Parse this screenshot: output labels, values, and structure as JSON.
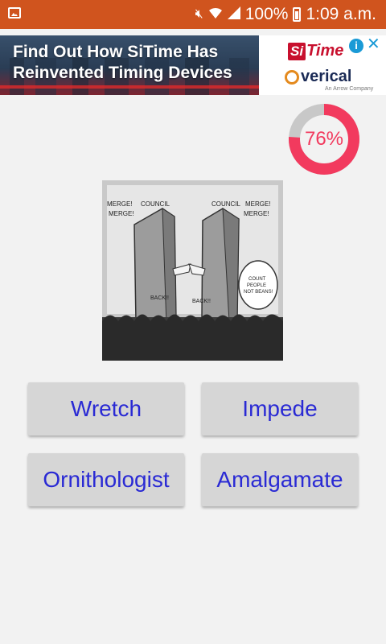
{
  "status_bar": {
    "battery_percent": "100%",
    "time": "1:09 a.m.",
    "icons": [
      "image-icon",
      "mute-icon",
      "wifi-icon",
      "signal-icon",
      "battery-charging-icon"
    ]
  },
  "ad": {
    "headline_line1": "Find Out How SiTime Has",
    "headline_line2": "Reinvented Timing Devices",
    "brand1_si": "Si",
    "brand1_rest": "Time",
    "brand2": "verical",
    "brand2_sub": "An Arrow Company",
    "info_icon": "i",
    "close_icon": "✕"
  },
  "progress": {
    "percent": 76,
    "label": "76%",
    "colors": {
      "filled": "#f23a5e",
      "track": "#c8c8c8"
    }
  },
  "cartoon": {
    "labels": [
      "MERGE! MERGE!",
      "COUNCIL",
      "COUNCIL",
      "MERGE! MERGE!",
      "COUNT PEOPLE NOT BEANS!",
      "BACK!!",
      "BACK!!"
    ]
  },
  "answers": {
    "option1": "Wretch",
    "option2": "Impede",
    "option3": "Ornithologist",
    "option4": "Amalgamate"
  },
  "colors": {
    "status_bar": "#d0541e",
    "answer_text": "#2a2ad4",
    "answer_bg": "#d6d6d6",
    "background": "#f2f2f2"
  }
}
